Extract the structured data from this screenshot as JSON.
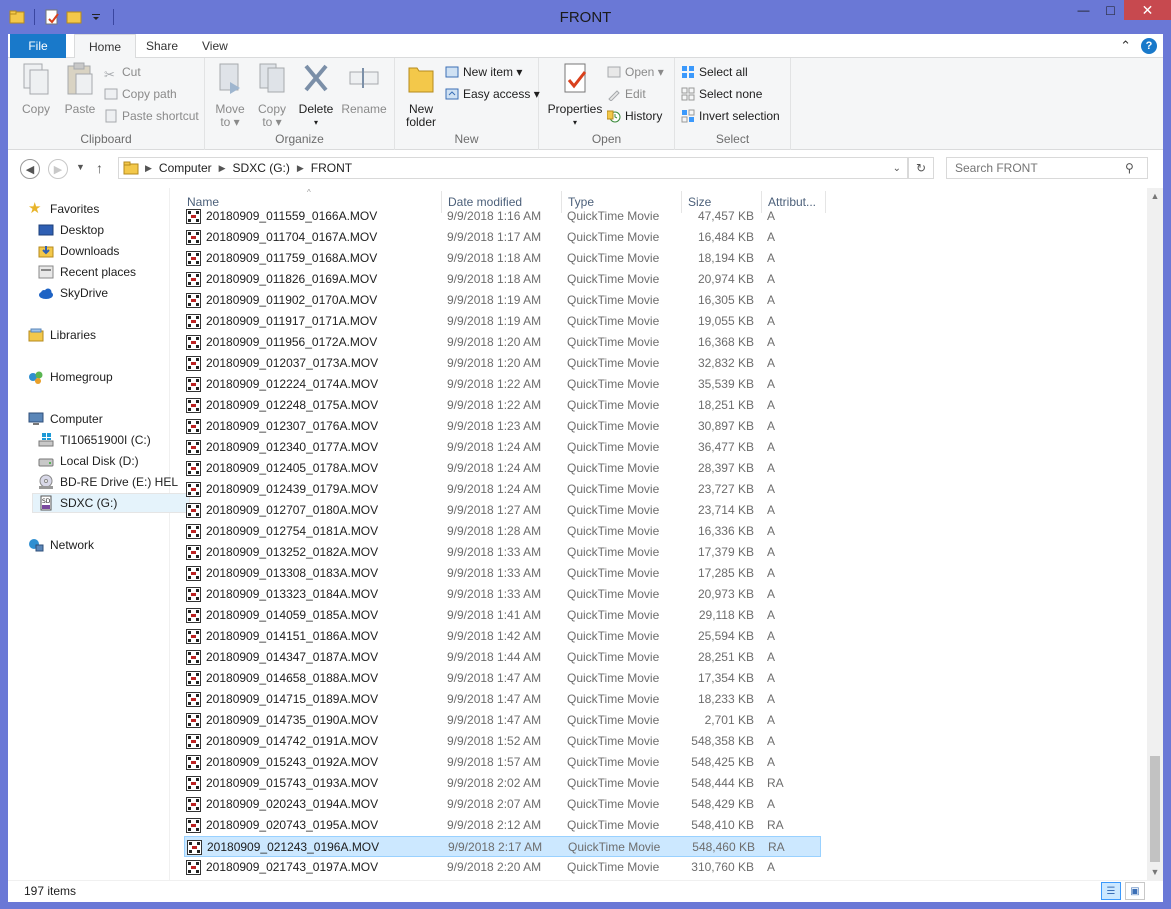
{
  "window": {
    "title": "FRONT",
    "minimize": "—",
    "maximize": "□",
    "close": "✕"
  },
  "ribbon_tabs": [
    "File",
    "Home",
    "Share",
    "View"
  ],
  "ribbon": {
    "clipboard": {
      "label": "Clipboard",
      "copy": "Copy",
      "paste": "Paste",
      "cut": "Cut",
      "copy_path": "Copy path",
      "paste_shortcut": "Paste shortcut"
    },
    "organize": {
      "label": "Organize",
      "move_to": "Move",
      "move_to2": "to ▾",
      "copy_to": "Copy",
      "copy_to2": "to ▾",
      "delete": "Delete",
      "delete2": "▾",
      "rename": "Rename"
    },
    "new": {
      "label": "New",
      "new_folder": "New",
      "new_folder2": "folder",
      "new_item": "New item ▾",
      "easy_access": "Easy access ▾"
    },
    "open": {
      "label": "Open",
      "properties": "Properties",
      "properties2": "▾",
      "open": "Open ▾",
      "edit": "Edit",
      "history": "History"
    },
    "select": {
      "label": "Select",
      "select_all": "Select all",
      "select_none": "Select none",
      "invert": "Invert selection"
    }
  },
  "address": {
    "crumbs": [
      "Computer",
      "SDXC (G:)",
      "FRONT"
    ],
    "search_placeholder": "Search FRONT"
  },
  "nav": {
    "favorites": "Favorites",
    "desktop": "Desktop",
    "downloads": "Downloads",
    "recent": "Recent places",
    "skydrive": "SkyDrive",
    "libraries": "Libraries",
    "homegroup": "Homegroup",
    "computer": "Computer",
    "drive_c": "TI10651900I (C:)",
    "drive_d": "Local Disk (D:)",
    "drive_e": "BD-RE Drive (E:) HEL",
    "drive_g": "SDXC (G:)",
    "network": "Network"
  },
  "columns": {
    "name": "Name",
    "date": "Date modified",
    "type": "Type",
    "size": "Size",
    "attr": "Attribut..."
  },
  "files": [
    {
      "name": "20180909_011559_0166A.MOV",
      "date": "9/9/2018 1:16 AM",
      "type": "QuickTime Movie",
      "size": "47,457 KB",
      "attr": "A"
    },
    {
      "name": "20180909_011704_0167A.MOV",
      "date": "9/9/2018 1:17 AM",
      "type": "QuickTime Movie",
      "size": "16,484 KB",
      "attr": "A"
    },
    {
      "name": "20180909_011759_0168A.MOV",
      "date": "9/9/2018 1:18 AM",
      "type": "QuickTime Movie",
      "size": "18,194 KB",
      "attr": "A"
    },
    {
      "name": "20180909_011826_0169A.MOV",
      "date": "9/9/2018 1:18 AM",
      "type": "QuickTime Movie",
      "size": "20,974 KB",
      "attr": "A"
    },
    {
      "name": "20180909_011902_0170A.MOV",
      "date": "9/9/2018 1:19 AM",
      "type": "QuickTime Movie",
      "size": "16,305 KB",
      "attr": "A"
    },
    {
      "name": "20180909_011917_0171A.MOV",
      "date": "9/9/2018 1:19 AM",
      "type": "QuickTime Movie",
      "size": "19,055 KB",
      "attr": "A"
    },
    {
      "name": "20180909_011956_0172A.MOV",
      "date": "9/9/2018 1:20 AM",
      "type": "QuickTime Movie",
      "size": "16,368 KB",
      "attr": "A"
    },
    {
      "name": "20180909_012037_0173A.MOV",
      "date": "9/9/2018 1:20 AM",
      "type": "QuickTime Movie",
      "size": "32,832 KB",
      "attr": "A"
    },
    {
      "name": "20180909_012224_0174A.MOV",
      "date": "9/9/2018 1:22 AM",
      "type": "QuickTime Movie",
      "size": "35,539 KB",
      "attr": "A"
    },
    {
      "name": "20180909_012248_0175A.MOV",
      "date": "9/9/2018 1:22 AM",
      "type": "QuickTime Movie",
      "size": "18,251 KB",
      "attr": "A"
    },
    {
      "name": "20180909_012307_0176A.MOV",
      "date": "9/9/2018 1:23 AM",
      "type": "QuickTime Movie",
      "size": "30,897 KB",
      "attr": "A"
    },
    {
      "name": "20180909_012340_0177A.MOV",
      "date": "9/9/2018 1:24 AM",
      "type": "QuickTime Movie",
      "size": "36,477 KB",
      "attr": "A"
    },
    {
      "name": "20180909_012405_0178A.MOV",
      "date": "9/9/2018 1:24 AM",
      "type": "QuickTime Movie",
      "size": "28,397 KB",
      "attr": "A"
    },
    {
      "name": "20180909_012439_0179A.MOV",
      "date": "9/9/2018 1:24 AM",
      "type": "QuickTime Movie",
      "size": "23,727 KB",
      "attr": "A"
    },
    {
      "name": "20180909_012707_0180A.MOV",
      "date": "9/9/2018 1:27 AM",
      "type": "QuickTime Movie",
      "size": "23,714 KB",
      "attr": "A"
    },
    {
      "name": "20180909_012754_0181A.MOV",
      "date": "9/9/2018 1:28 AM",
      "type": "QuickTime Movie",
      "size": "16,336 KB",
      "attr": "A"
    },
    {
      "name": "20180909_013252_0182A.MOV",
      "date": "9/9/2018 1:33 AM",
      "type": "QuickTime Movie",
      "size": "17,379 KB",
      "attr": "A"
    },
    {
      "name": "20180909_013308_0183A.MOV",
      "date": "9/9/2018 1:33 AM",
      "type": "QuickTime Movie",
      "size": "17,285 KB",
      "attr": "A"
    },
    {
      "name": "20180909_013323_0184A.MOV",
      "date": "9/9/2018 1:33 AM",
      "type": "QuickTime Movie",
      "size": "20,973 KB",
      "attr": "A"
    },
    {
      "name": "20180909_014059_0185A.MOV",
      "date": "9/9/2018 1:41 AM",
      "type": "QuickTime Movie",
      "size": "29,118 KB",
      "attr": "A"
    },
    {
      "name": "20180909_014151_0186A.MOV",
      "date": "9/9/2018 1:42 AM",
      "type": "QuickTime Movie",
      "size": "25,594 KB",
      "attr": "A"
    },
    {
      "name": "20180909_014347_0187A.MOV",
      "date": "9/9/2018 1:44 AM",
      "type": "QuickTime Movie",
      "size": "28,251 KB",
      "attr": "A"
    },
    {
      "name": "20180909_014658_0188A.MOV",
      "date": "9/9/2018 1:47 AM",
      "type": "QuickTime Movie",
      "size": "17,354 KB",
      "attr": "A"
    },
    {
      "name": "20180909_014715_0189A.MOV",
      "date": "9/9/2018 1:47 AM",
      "type": "QuickTime Movie",
      "size": "18,233 KB",
      "attr": "A"
    },
    {
      "name": "20180909_014735_0190A.MOV",
      "date": "9/9/2018 1:47 AM",
      "type": "QuickTime Movie",
      "size": "2,701 KB",
      "attr": "A"
    },
    {
      "name": "20180909_014742_0191A.MOV",
      "date": "9/9/2018 1:52 AM",
      "type": "QuickTime Movie",
      "size": "548,358 KB",
      "attr": "A"
    },
    {
      "name": "20180909_015243_0192A.MOV",
      "date": "9/9/2018 1:57 AM",
      "type": "QuickTime Movie",
      "size": "548,425 KB",
      "attr": "A"
    },
    {
      "name": "20180909_015743_0193A.MOV",
      "date": "9/9/2018 2:02 AM",
      "type": "QuickTime Movie",
      "size": "548,444 KB",
      "attr": "RA"
    },
    {
      "name": "20180909_020243_0194A.MOV",
      "date": "9/9/2018 2:07 AM",
      "type": "QuickTime Movie",
      "size": "548,429 KB",
      "attr": "A"
    },
    {
      "name": "20180909_020743_0195A.MOV",
      "date": "9/9/2018 2:12 AM",
      "type": "QuickTime Movie",
      "size": "548,410 KB",
      "attr": "RA"
    },
    {
      "name": "20180909_021243_0196A.MOV",
      "date": "9/9/2018 2:17 AM",
      "type": "QuickTime Movie",
      "size": "548,460 KB",
      "attr": "RA",
      "selected": true
    },
    {
      "name": "20180909_021743_0197A.MOV",
      "date": "9/9/2018 2:20 AM",
      "type": "QuickTime Movie",
      "size": "310,760 KB",
      "attr": "A"
    }
  ],
  "status": {
    "count": "197 items"
  },
  "colors": {
    "frame": "#6a78d6",
    "file_tab": "#1979ca",
    "close": "#c7494f",
    "selection": "#cce8ff"
  }
}
